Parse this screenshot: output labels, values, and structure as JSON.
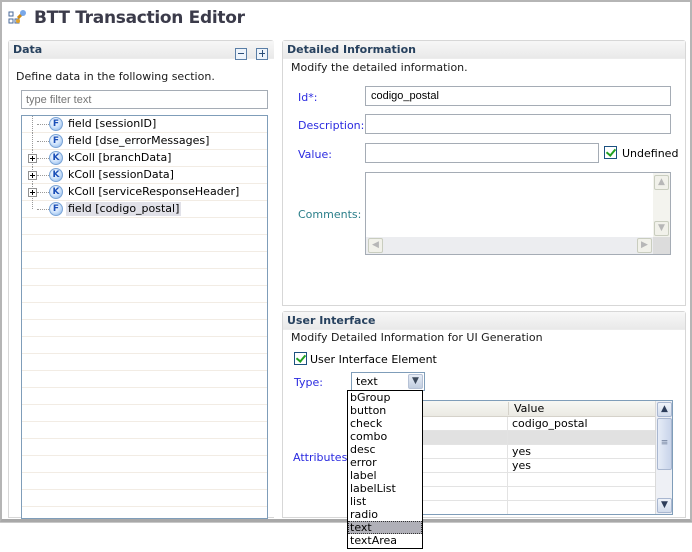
{
  "editor": {
    "title": "BTT Transaction Editor",
    "icon": "transaction-editor-icon"
  },
  "data_section": {
    "header": "Data",
    "collapse_all_icon": "collapse-all-icon",
    "expand_all_icon": "expand-all-icon",
    "description": "Define data in the following section.",
    "filter_placeholder": "type filter text",
    "tree": [
      {
        "type": "field",
        "badge": "F",
        "label": "field [sessionID]",
        "expandable": false,
        "selected": false
      },
      {
        "type": "field",
        "badge": "F",
        "label": "field [dse_errorMessages]",
        "expandable": false,
        "selected": false
      },
      {
        "type": "kColl",
        "badge": "K",
        "label": "kColl [branchData]",
        "expandable": true,
        "selected": false
      },
      {
        "type": "kColl",
        "badge": "K",
        "label": "kColl [sessionData]",
        "expandable": true,
        "selected": false
      },
      {
        "type": "kColl",
        "badge": "K",
        "label": "kColl [serviceResponseHeader]",
        "expandable": true,
        "selected": false
      },
      {
        "type": "field",
        "badge": "F",
        "label": "field [codigo_postal]",
        "expandable": false,
        "selected": true
      }
    ]
  },
  "detail_section": {
    "header": "Detailed Information",
    "description": "Modify the detailed information.",
    "id_label": "Id*:",
    "id_value": "codigo_postal",
    "description_label": "Description:",
    "description_value": "",
    "value_label": "Value:",
    "value_value": "",
    "undefined_label": "Undefined",
    "undefined_checked": true,
    "comments_label": "Comments:",
    "comments_value": ""
  },
  "ui_section": {
    "header": "User Interface",
    "description": "Modify Detailed Information for UI Generation",
    "ui_element_label": "User Interface Element",
    "ui_element_checked": true,
    "type_label": "Type:",
    "type_value": "text",
    "attributes_label": "Attributes:",
    "attributes_columns": [
      "",
      "Value"
    ],
    "attributes_rows": [
      {
        "name": "",
        "value": "codigo_postal",
        "selected": false
      },
      {
        "name": "",
        "value": "",
        "selected": true
      },
      {
        "name": "",
        "value": "yes",
        "selected": false
      },
      {
        "name": "",
        "value": "yes",
        "selected": false
      },
      {
        "name": "",
        "value": "",
        "selected": false
      },
      {
        "name": "",
        "value": "",
        "selected": false
      },
      {
        "name": "",
        "value": "",
        "selected": false
      }
    ],
    "type_options": [
      "bGroup",
      "button",
      "check",
      "combo",
      "desc",
      "error",
      "label",
      "labelList",
      "list",
      "radio",
      "text",
      "textArea"
    ],
    "type_highlighted": "text"
  }
}
